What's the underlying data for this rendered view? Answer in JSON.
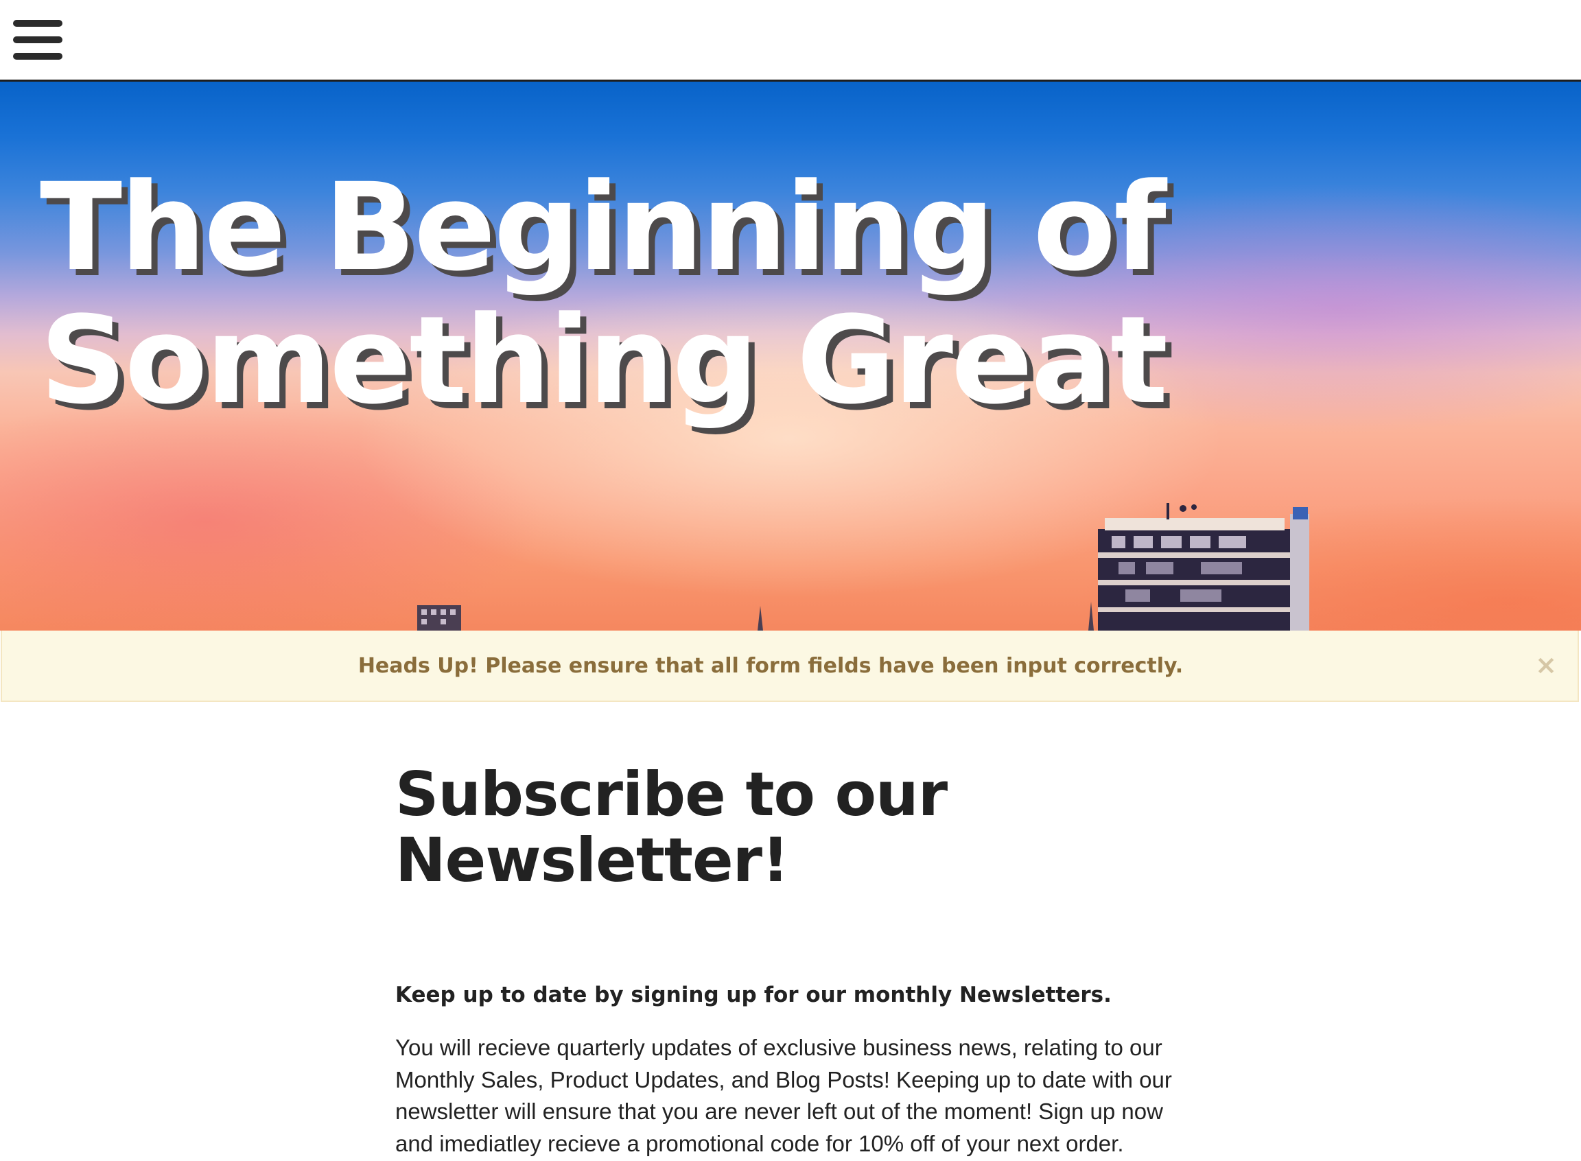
{
  "nav": {
    "menu_icon": "hamburger-menu-icon"
  },
  "hero": {
    "title_line1": "The Beginning of",
    "title_line2": "Something Great"
  },
  "alert": {
    "message": "Heads Up! Please ensure that all form fields have been input correctly.",
    "close_symbol": "×",
    "background_color": "#fcf8e3",
    "text_color": "#8a6d3b"
  },
  "newsletter": {
    "heading": "Subscribe to our Newsletter!",
    "lead": "Keep up to date by signing up for our monthly Newsletters.",
    "body": "You will recieve quarterly updates of exclusive business news, relating to our Monthly Sales, Product Updates, and Blog Posts! Keeping up to date with our newsletter will ensure that you are never left out of the moment! Sign up now and imediatley recieve a promotional code for 10% off of your next order."
  }
}
